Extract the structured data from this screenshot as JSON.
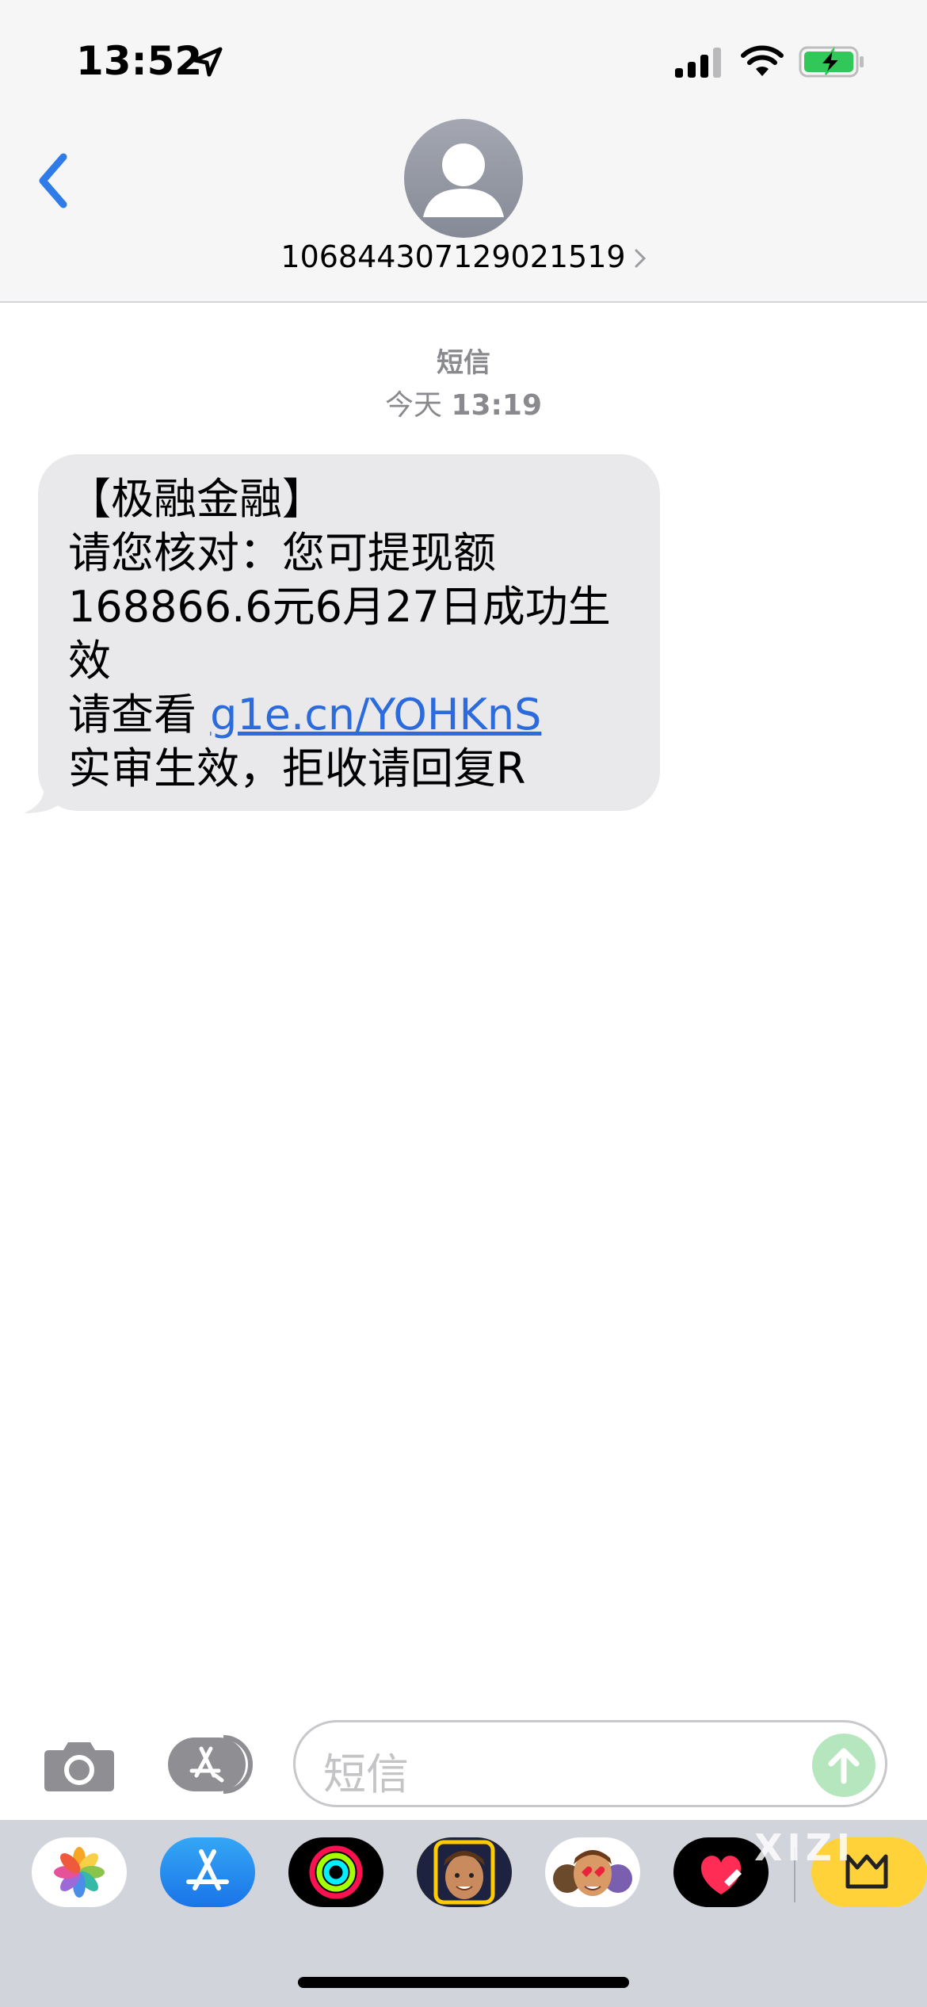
{
  "status_bar": {
    "time": "13:52"
  },
  "header": {
    "contact": "106844307129021519"
  },
  "thread": {
    "service_label": "短信",
    "date_label": "今天",
    "time_label": "13:19"
  },
  "message": {
    "lines": [
      "【极融金融】",
      "请您核对：您可提现额",
      "168866.6元6月27日成功生",
      "效",
      "请查看 ",
      "实审生效，拒收请回复R"
    ],
    "link": "g1e.cn/YOHKnS"
  },
  "input": {
    "placeholder": "短信"
  },
  "app_drawer": {
    "apps": [
      "photos-icon",
      "app-store-icon",
      "activity-icon",
      "memoji-icon",
      "memoji-stickers-icon",
      "digital-touch-icon",
      "more-app-icon"
    ]
  },
  "watermark": "XIZI",
  "colors": {
    "link": "#2c6bdb",
    "back_accent": "#2f7be8",
    "bubble": "#e9e9eb",
    "send": "#b6e6bd",
    "battery": "#32c759"
  }
}
